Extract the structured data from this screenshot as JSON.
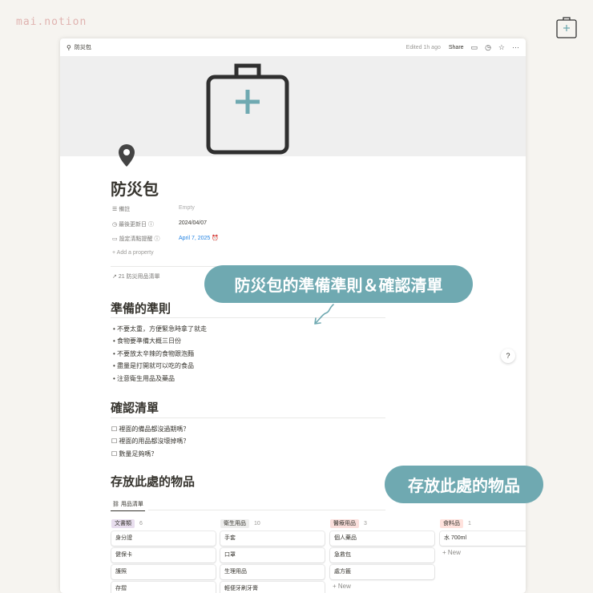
{
  "brand": "mai.notion",
  "topbar": {
    "title": "防災包",
    "edited": "Edited 1h ago",
    "share": "Share"
  },
  "page": {
    "title": "防災包",
    "props": [
      {
        "label": "備註",
        "value": "Empty"
      },
      {
        "label": "最後更新日",
        "value": "2024/04/07"
      },
      {
        "label": "設定清點提醒",
        "value": "April 7, 2025"
      }
    ],
    "add_property": "Add a property",
    "relation": "21 防災用品清單"
  },
  "s1": {
    "heading": "準備的準則",
    "items": [
      "不要太重，方便緊急時拿了就走",
      "食物要準備大概三日份",
      "不要放太辛辣的食物跟泡麵",
      "盡量是打開就可以吃的食品",
      "注意衛生用品及藥品"
    ]
  },
  "s2": {
    "heading": "確認清單",
    "items": [
      "裡面的備品都沒過期嗎？",
      "裡面的用品都沒壞掉嗎？",
      "數量足夠嗎？"
    ]
  },
  "s3": {
    "heading": "存放此處的物品",
    "tab": "用品清單"
  },
  "board": [
    {
      "name": "文書類",
      "count": "6",
      "color": "#e8deee",
      "cards": [
        "身分證",
        "健保卡",
        "護照",
        "存摺"
      ]
    },
    {
      "name": "衛生用品",
      "count": "10",
      "color": "#eeeeed",
      "cards": [
        "手套",
        "口罩",
        "生理用品",
        "輕便牙刷牙膏"
      ]
    },
    {
      "name": "醫療用品",
      "count": "3",
      "color": "#fadfdc",
      "cards": [
        "個人藥品",
        "急救包",
        "處方籤"
      ],
      "new": "New"
    },
    {
      "name": "食料品",
      "count": "1",
      "color": "#ffe2dd",
      "cards": [
        "水 700ml"
      ],
      "new": "New"
    }
  ],
  "callouts": {
    "c1": "防災包的準備準則＆確認清單",
    "c2": "存放此處的物品"
  },
  "help": "?"
}
